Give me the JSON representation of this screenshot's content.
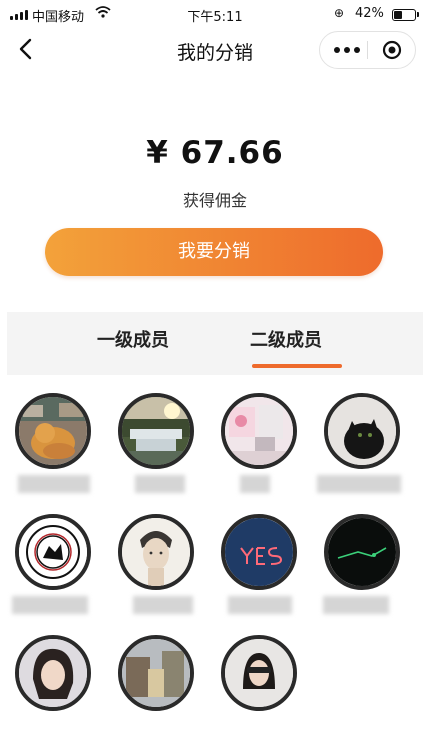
{
  "status_bar": {
    "carrier": "中国移动",
    "time": "下午5:11",
    "battery_percent": "42%",
    "battery_level": 0.42
  },
  "nav": {
    "title": "我的分销"
  },
  "earnings": {
    "amount": "¥ 67.66",
    "label": "获得佣金"
  },
  "cta": {
    "label": "我要分销"
  },
  "tabs": [
    {
      "label": "一级成员",
      "active": false
    },
    {
      "label": "二级成员",
      "active": true
    }
  ],
  "members": [
    {
      "name_visible": "",
      "avatar": "orange-cat-photo"
    },
    {
      "name_visible": "",
      "avatar": "waterfall-photo"
    },
    {
      "name_visible": "",
      "avatar": "room-photo"
    },
    {
      "name_visible": "",
      "avatar": "black-cat-photo"
    },
    {
      "name_visible": "",
      "avatar": "club-logo"
    },
    {
      "name_visible": "",
      "avatar": "portrait-sketch"
    },
    {
      "name_visible": "",
      "avatar": "neon-yes-sign"
    },
    {
      "name_visible": "",
      "avatar": "dark-neon-photo"
    },
    {
      "name_visible": "",
      "avatar": "woman-portrait"
    },
    {
      "name_visible": "",
      "avatar": "street-photo"
    },
    {
      "name_visible": "",
      "avatar": "selfie-photo"
    }
  ],
  "colors": {
    "accent": "#ee6a2c",
    "cta_start": "#f3a23a",
    "cta_end": "#ee6b2c",
    "tab_bg": "#f4f4f4"
  }
}
